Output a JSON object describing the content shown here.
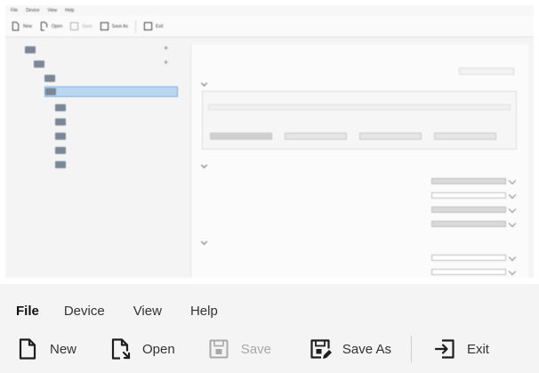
{
  "menu": {
    "file": "File",
    "device": "Device",
    "view": "View",
    "help": "Help"
  },
  "toolbar": {
    "new": {
      "label": "New",
      "icon": "new-document-icon",
      "enabled": true
    },
    "open": {
      "label": "Open",
      "icon": "open-document-icon",
      "enabled": true
    },
    "save": {
      "label": "Save",
      "icon": "save-icon",
      "enabled": false
    },
    "save_as": {
      "label": "Save As",
      "icon": "save-as-icon",
      "enabled": true
    },
    "exit": {
      "label": "Exit",
      "icon": "exit-icon",
      "enabled": true
    }
  },
  "colors": {
    "background": "#f4f4f4",
    "text": "#333333",
    "disabled_text": "#a8a8a8",
    "selection": "#b9d6f2",
    "separator": "#cfcfcf"
  }
}
